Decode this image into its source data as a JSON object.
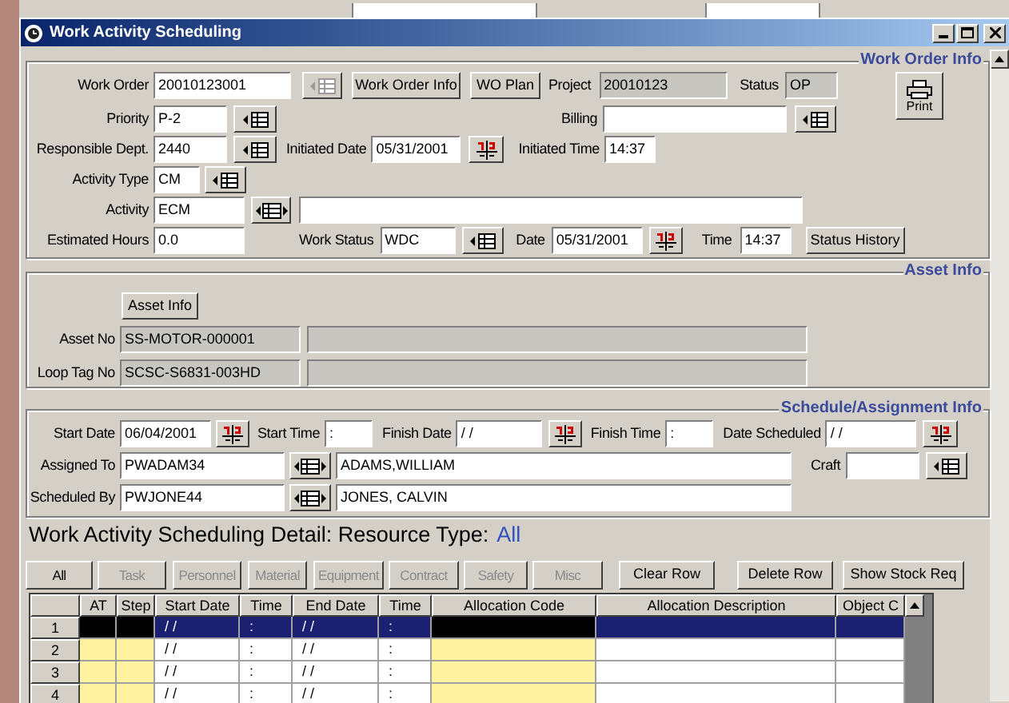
{
  "window": {
    "title": "Work Activity Scheduling"
  },
  "work_order_info": {
    "title": "Work Order Info",
    "print_button": {
      "label": "Print"
    },
    "rows": [
      {
        "items": [
          {
            "kind": "label",
            "text": "Work Order"
          },
          {
            "kind": "input",
            "value": "20010123001"
          },
          {
            "kind": "lookup",
            "disabled": true
          },
          {
            "kind": "button",
            "label": "Work Order Info"
          },
          {
            "kind": "button",
            "label": "WO Plan"
          },
          {
            "kind": "label",
            "text": "Project"
          },
          {
            "kind": "readonly",
            "value": "20010123"
          },
          {
            "kind": "label",
            "text": "Status"
          },
          {
            "kind": "readonly",
            "value": "OP"
          }
        ]
      },
      {
        "items": [
          {
            "kind": "label",
            "text": "Priority"
          },
          {
            "kind": "input",
            "value": "P-2"
          },
          {
            "kind": "lookup",
            "disabled": false
          },
          {
            "kind": "label",
            "text": "Billing"
          },
          {
            "kind": "input"
          },
          {
            "kind": "lookup",
            "disabled": false
          }
        ]
      },
      {
        "items": [
          {
            "kind": "label",
            "text": "Responsible Dept."
          },
          {
            "kind": "input",
            "value": "2440"
          },
          {
            "kind": "lookup",
            "disabled": false
          },
          {
            "kind": "label",
            "text": "Initiated Date"
          },
          {
            "kind": "input",
            "value": "05/31/2001"
          },
          {
            "kind": "calendar"
          },
          {
            "kind": "label",
            "text": "Initiated Time"
          },
          {
            "kind": "input",
            "value": "14:37"
          }
        ]
      },
      {
        "items": [
          {
            "kind": "label",
            "text": "Activity Type"
          },
          {
            "kind": "input",
            "value": "CM"
          },
          {
            "kind": "lookup",
            "disabled": false
          }
        ]
      },
      {
        "items": [
          {
            "kind": "label",
            "text": "Activity"
          },
          {
            "kind": "input",
            "value": "ECM"
          },
          {
            "kind": "picker"
          },
          {
            "kind": "input"
          }
        ]
      },
      {
        "items": [
          {
            "kind": "label",
            "text": "Estimated Hours"
          },
          {
            "kind": "input",
            "value": "0.0"
          },
          {
            "kind": "label",
            "text": "Work Status"
          },
          {
            "kind": "input",
            "value": "WDC"
          },
          {
            "kind": "lookup",
            "disabled": false
          },
          {
            "kind": "label",
            "text": "Date"
          },
          {
            "kind": "input",
            "value": "05/31/2001"
          },
          {
            "kind": "calendar"
          },
          {
            "kind": "label",
            "text": "Time"
          },
          {
            "kind": "input",
            "value": "14:37"
          },
          {
            "kind": "button",
            "label": "Status History"
          }
        ]
      }
    ]
  },
  "asset_info": {
    "title": "Asset Info",
    "button": {
      "label": "Asset Info"
    },
    "rows": [
      {
        "items": [
          {
            "kind": "label",
            "text": "Asset No"
          },
          {
            "kind": "readonly",
            "value": "SS-MOTOR-000001"
          },
          {
            "kind": "readonly"
          }
        ]
      },
      {
        "items": [
          {
            "kind": "label",
            "text": "Loop Tag No"
          },
          {
            "kind": "readonly",
            "value": "SCSC-S6831-003HD"
          },
          {
            "kind": "readonly"
          }
        ]
      }
    ]
  },
  "schedule_assignment_info": {
    "title": "Schedule/Assignment Info",
    "rows": [
      {
        "items": [
          {
            "kind": "label",
            "text": "Start Date"
          },
          {
            "kind": "input",
            "value": "06/04/2001"
          },
          {
            "kind": "calendar"
          },
          {
            "kind": "label",
            "text": "Start Time"
          },
          {
            "kind": "input",
            "value": ":"
          },
          {
            "kind": "label",
            "text": "Finish Date"
          },
          {
            "kind": "input",
            "value": "/ /"
          },
          {
            "kind": "calendar"
          },
          {
            "kind": "label",
            "text": "Finish Time"
          },
          {
            "kind": "input",
            "value": ":"
          },
          {
            "kind": "label",
            "text": "Date Scheduled"
          },
          {
            "kind": "input",
            "value": "/ /"
          },
          {
            "kind": "calendar"
          }
        ]
      },
      {
        "items": [
          {
            "kind": "label",
            "text": "Assigned To"
          },
          {
            "kind": "input",
            "value": "PWADAM34"
          },
          {
            "kind": "picker"
          },
          {
            "kind": "input",
            "value": "ADAMS,WILLIAM"
          },
          {
            "kind": "label",
            "text": "Craft"
          },
          {
            "kind": "input"
          },
          {
            "kind": "lookup",
            "disabled": false
          }
        ]
      },
      {
        "items": [
          {
            "kind": "label",
            "text": "Scheduled By"
          },
          {
            "kind": "input",
            "value": "PWJONE44"
          },
          {
            "kind": "picker"
          },
          {
            "kind": "input",
            "value": "JONES, CALVIN"
          }
        ]
      }
    ]
  },
  "detail": {
    "heading": "Work Activity Scheduling Detail: Resource Type:",
    "resource_type": "All",
    "resource_tabs": [
      {
        "label": "All",
        "disabled": false
      },
      {
        "label": "Task",
        "disabled": true
      },
      {
        "label": "Personnel",
        "disabled": true
      },
      {
        "label": "Material",
        "disabled": true
      },
      {
        "label": "Equipment",
        "disabled": true
      },
      {
        "label": "Contract",
        "disabled": true
      },
      {
        "label": "Safety",
        "disabled": true
      },
      {
        "label": "Misc",
        "disabled": true
      }
    ],
    "actions": [
      "Clear Row",
      "Delete Row",
      "Show Stock Req"
    ],
    "columns": [
      {
        "label": "AT",
        "required": true
      },
      {
        "label": "Step",
        "required": true
      },
      {
        "label": "Start Date",
        "required": false
      },
      {
        "label": "Time",
        "required": false
      },
      {
        "label": "End Date",
        "required": false
      },
      {
        "label": "Time",
        "required": false
      },
      {
        "label": "Allocation Code",
        "required": true
      },
      {
        "label": "Allocation Description",
        "required": false
      },
      {
        "label": "Object C",
        "required": false
      }
    ],
    "rows": [
      {
        "number": "1",
        "selected": true,
        "cells": [
          "",
          "",
          "/ /",
          ":",
          "/ /",
          ":",
          "",
          "",
          ""
        ]
      },
      {
        "number": "2",
        "selected": false,
        "cells": [
          "",
          "",
          "/ /",
          ":",
          "/ /",
          ":",
          "",
          "",
          ""
        ]
      },
      {
        "number": "3",
        "selected": false,
        "cells": [
          "",
          "",
          "/ /",
          ":",
          "/ /",
          ":",
          "",
          "",
          ""
        ]
      },
      {
        "number": "4",
        "selected": false,
        "cells": [
          "",
          "",
          "/ /",
          ":",
          "/ /",
          ":",
          "",
          "",
          ""
        ]
      }
    ]
  }
}
